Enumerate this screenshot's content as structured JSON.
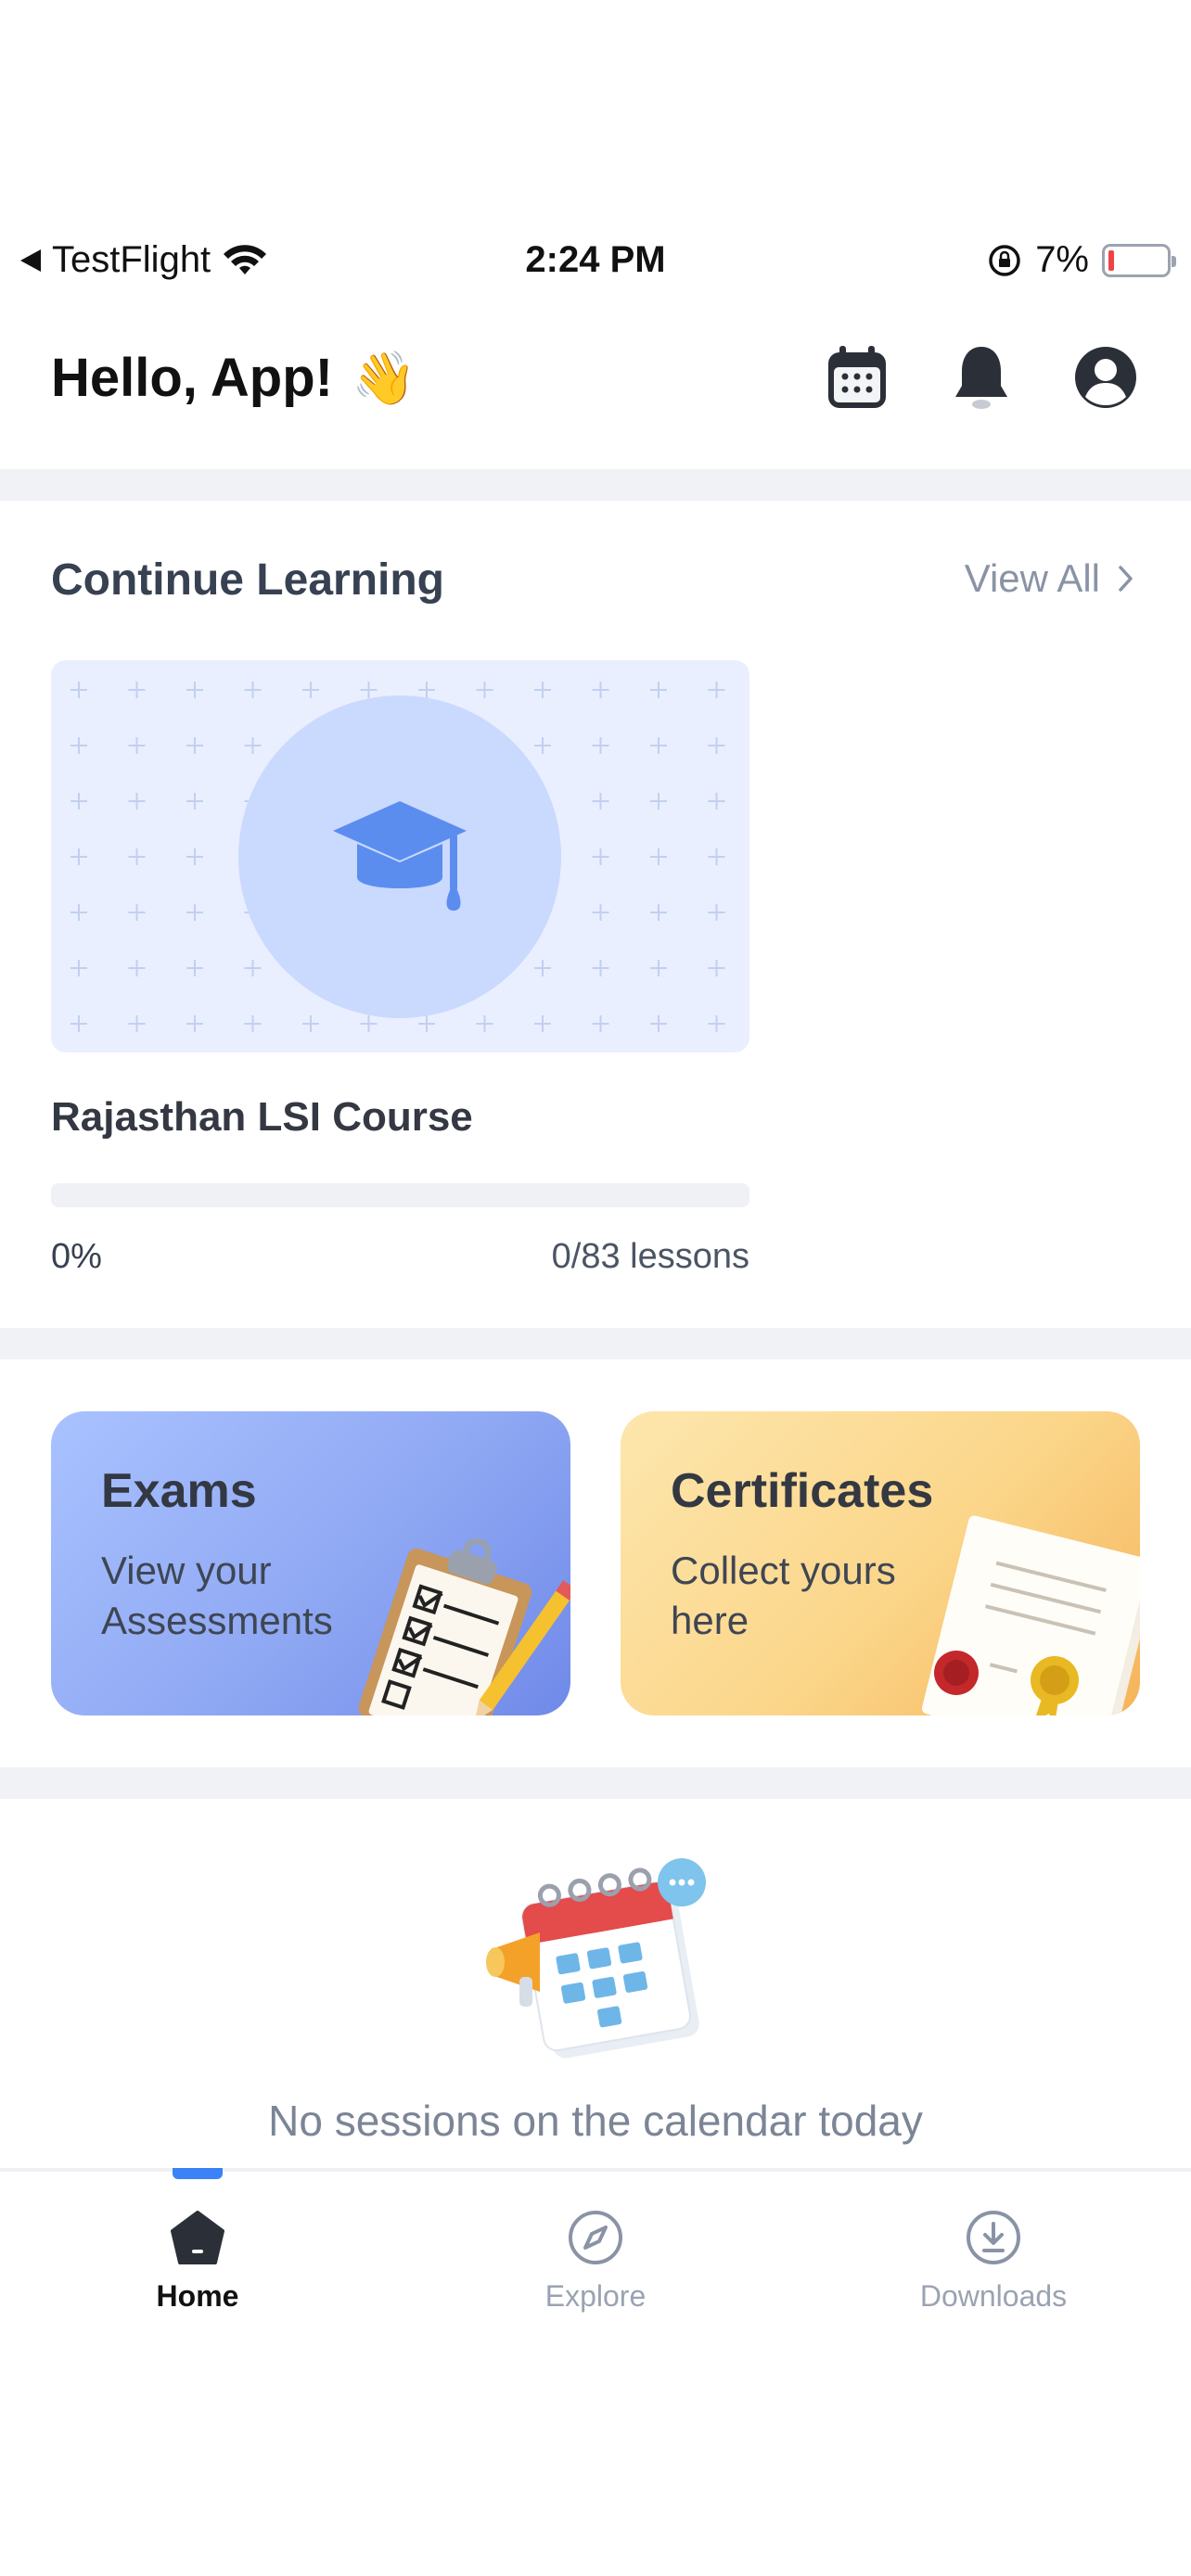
{
  "status_bar": {
    "back_app": "TestFlight",
    "time": "2:24 PM",
    "battery": "7%"
  },
  "header": {
    "greeting": "Hello, App!",
    "wave_emoji": "👋",
    "icons": [
      "calendar-icon",
      "bell-icon",
      "profile-icon"
    ]
  },
  "continue_learning": {
    "title": "Continue Learning",
    "view_all": "View All",
    "course": {
      "title": "Rajasthan LSI Course",
      "progress_percent_label": "0%",
      "progress_fraction": 0,
      "lessons_label": "0/83 lessons"
    }
  },
  "tiles": {
    "exams": {
      "title": "Exams",
      "subtitle": "View your Assessments"
    },
    "certificates": {
      "title": "Certificates",
      "subtitle": "Collect yours here"
    }
  },
  "calendar_empty": {
    "message": "No sessions on the calendar today"
  },
  "tabbar": {
    "items": [
      {
        "label": "Home",
        "icon": "home-icon",
        "active": true
      },
      {
        "label": "Explore",
        "icon": "compass-icon",
        "active": false
      },
      {
        "label": "Downloads",
        "icon": "download-icon",
        "active": false
      }
    ]
  },
  "colors": {
    "accent": "#3b82f6",
    "exams_tile": "#8fa8f3",
    "certificates_tile": "#fbd68a",
    "divider": "#f0f2f6"
  }
}
